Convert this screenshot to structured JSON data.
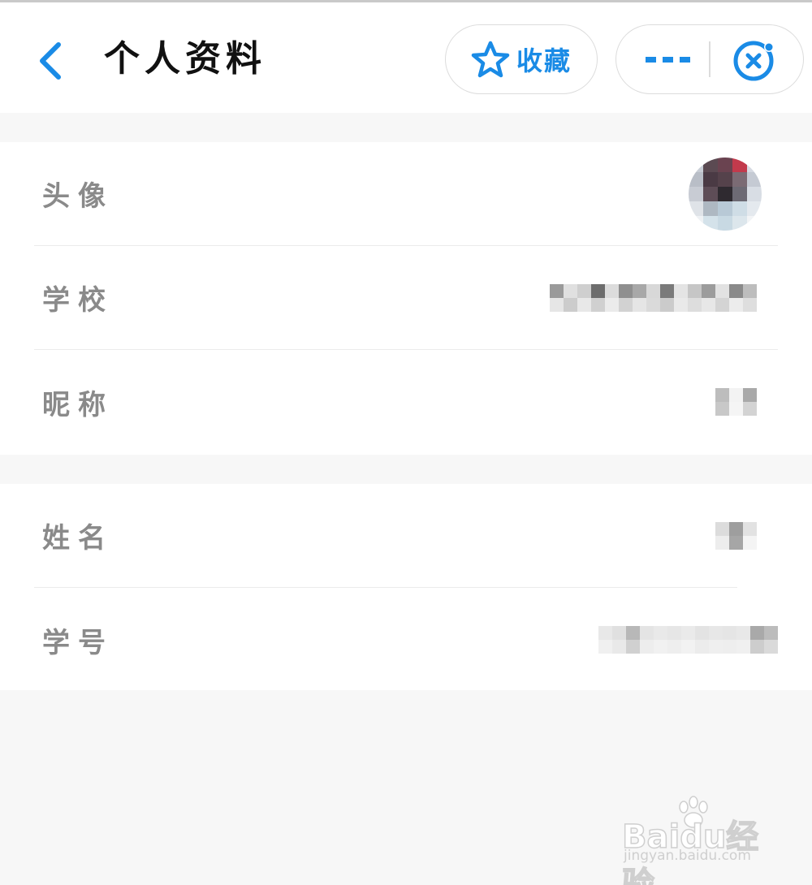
{
  "header": {
    "title": "个人资料",
    "favorite_label": "收藏"
  },
  "colors": {
    "accent": "#1a8be6",
    "label_gray": "#8a8a8a",
    "background": "#f7f7f7"
  },
  "icons": {
    "back": "chevron-left-icon",
    "favorite": "star-outline-icon",
    "more": "more-dots-icon",
    "close": "mini-program-close-icon"
  },
  "profile_section": {
    "rows": [
      {
        "label": "头像"
      },
      {
        "label": "学校"
      },
      {
        "label": "昵称"
      }
    ]
  },
  "student_section": {
    "rows": [
      {
        "label": "姓名"
      },
      {
        "label": "学号"
      }
    ]
  },
  "watermark": {
    "logo": "Baidu经验",
    "url": "jingyan.baidu.com"
  }
}
